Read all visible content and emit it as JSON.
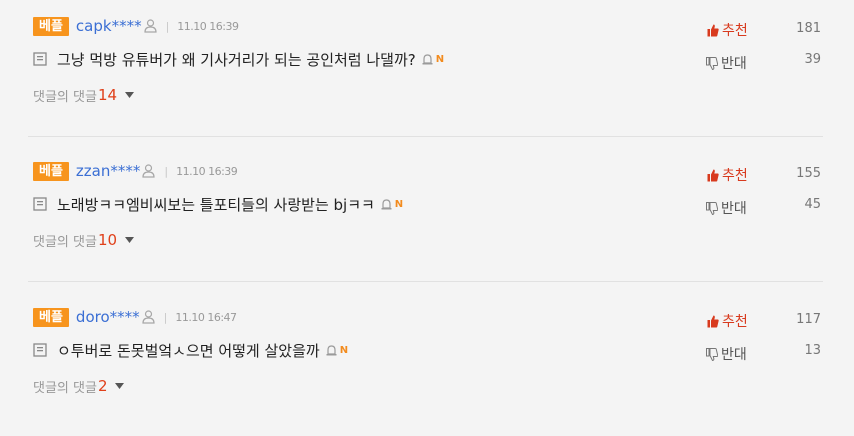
{
  "comments": [
    {
      "badge": "베플",
      "user": "capk****",
      "time": "11.10 16:39",
      "text": "그냥 먹방 유튜버가 왜 기사거리가 되는 공인처럼 나댈까?",
      "new_mark": "N",
      "reply_label": "댓글의 댓글",
      "reply_count": "14",
      "recommend_label": "추천",
      "recommend_count": "181",
      "oppose_label": "반대",
      "oppose_count": "39"
    },
    {
      "badge": "베플",
      "user": "zzan****",
      "time": "11.10 16:39",
      "text": "노래방ㅋㅋ엠비씨보는 틀포티들의 사랑받는 bjㅋㅋ",
      "new_mark": "N",
      "reply_label": "댓글의 댓글",
      "reply_count": "10",
      "recommend_label": "추천",
      "recommend_count": "155",
      "oppose_label": "반대",
      "oppose_count": "45"
    },
    {
      "badge": "베플",
      "user": "doro****",
      "time": "11.10 16:47",
      "text": "ㅇ투버로 돈못벌엌ㅅ으면 어떻게 살았을까",
      "new_mark": "N",
      "reply_label": "댓글의 댓글",
      "reply_count": "2",
      "recommend_label": "추천",
      "recommend_count": "117",
      "oppose_label": "반대",
      "oppose_count": "13"
    }
  ],
  "colors": {
    "badge": "#f7941d",
    "user": "#3b6fd4",
    "recommend": "#d83a1e",
    "reply_count": "#e0401a"
  },
  "icons": {
    "user": "person-icon",
    "comment": "document-icon",
    "alarm": "alarm-bell-icon",
    "recommend": "thumbs-up-icon",
    "oppose": "thumbs-down-icon",
    "expand": "chevron-down-icon"
  }
}
